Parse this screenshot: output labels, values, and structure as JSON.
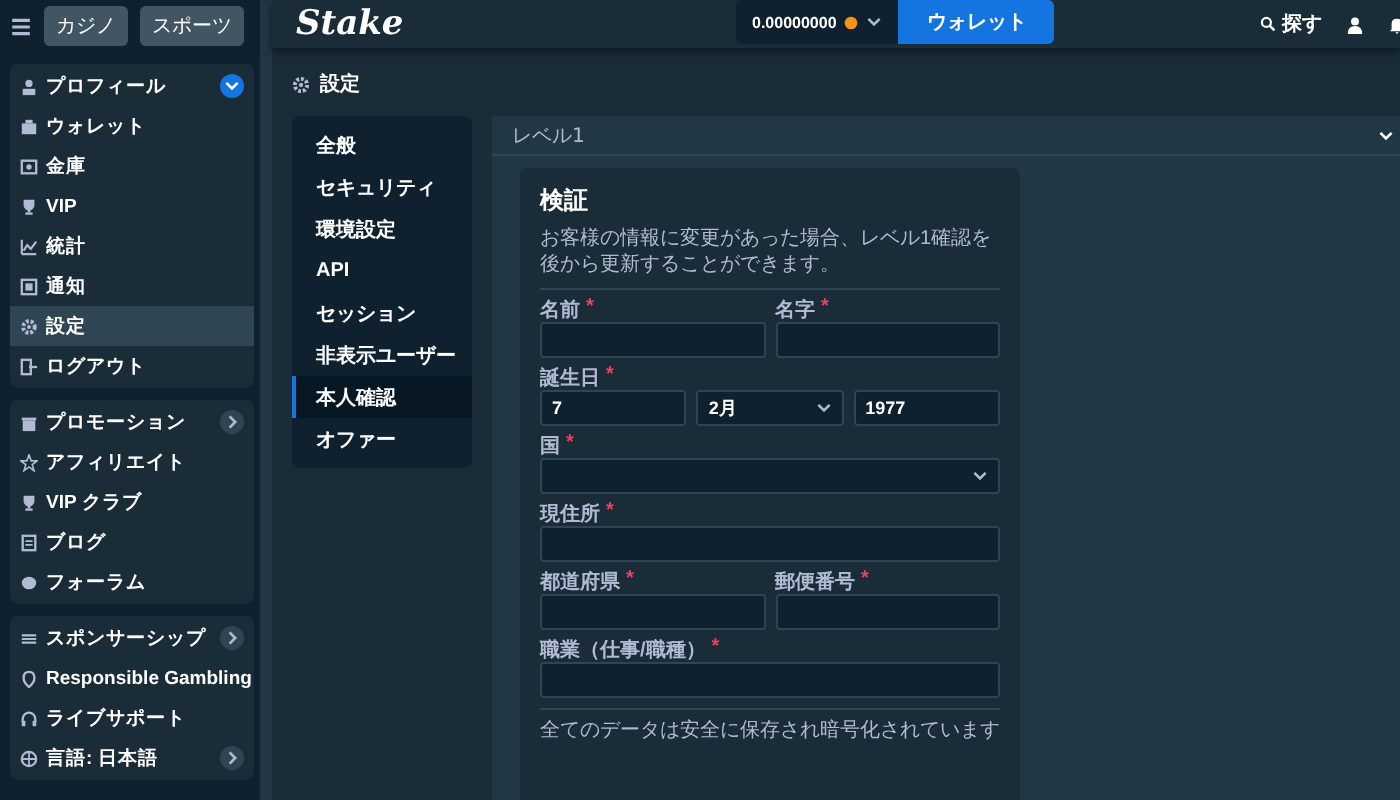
{
  "header": {
    "tabs": [
      {
        "label": "カジノ",
        "selected": false
      },
      {
        "label": "スポーツ",
        "selected": false
      }
    ],
    "logo": "Stake",
    "balance": "0.00000000",
    "wallet_button": "ウォレット",
    "search_label": "探す"
  },
  "sidebar": {
    "groups": [
      {
        "items": [
          {
            "label": "プロフィール",
            "kind": "expandable",
            "expanded": true,
            "selected": false
          },
          {
            "label": "ウォレット",
            "kind": "link",
            "selected": false
          },
          {
            "label": "金庫",
            "kind": "link",
            "selected": false
          },
          {
            "label": "VIP",
            "kind": "link",
            "selected": false
          },
          {
            "label": "統計",
            "kind": "link",
            "selected": false
          },
          {
            "label": "通知",
            "kind": "link",
            "selected": false
          },
          {
            "label": "設定",
            "kind": "link",
            "selected": true
          },
          {
            "label": "ログアウト",
            "kind": "link",
            "selected": false
          }
        ]
      },
      {
        "items": [
          {
            "label": "プロモーション",
            "kind": "expandable",
            "expanded": false,
            "selected": false
          },
          {
            "label": "アフィリエイト",
            "kind": "link",
            "selected": false
          },
          {
            "label": "VIP クラブ",
            "kind": "link",
            "selected": false
          },
          {
            "label": "ブログ",
            "kind": "link",
            "selected": false
          },
          {
            "label": "フォーラム",
            "kind": "link",
            "selected": false
          }
        ]
      },
      {
        "items": [
          {
            "label": "スポンサーシップ",
            "kind": "expandable",
            "expanded": false,
            "selected": false
          },
          {
            "label": "Responsible Gambling",
            "kind": "link",
            "selected": false
          },
          {
            "label": "ライブサポート",
            "kind": "link",
            "selected": false
          },
          {
            "label": "言語: 日本語",
            "kind": "expandable",
            "expanded": false,
            "selected": false
          }
        ]
      }
    ]
  },
  "settings": {
    "title": "設定",
    "menu": [
      {
        "label": "全般",
        "selected": false
      },
      {
        "label": "セキュリティ",
        "selected": false
      },
      {
        "label": "環境設定",
        "selected": false
      },
      {
        "label": "API",
        "selected": false
      },
      {
        "label": "セッション",
        "selected": false
      },
      {
        "label": "非表示ユーザー",
        "selected": false
      },
      {
        "label": "本人確認",
        "selected": true
      },
      {
        "label": "オファー",
        "selected": false
      }
    ],
    "section": {
      "title": "レベル1",
      "expanded": true
    },
    "card": {
      "title": "検証",
      "description": "お客様の情報に変更があった場合、レベル1確認を後から更新することができます。",
      "rows": [
        {
          "fields": [
            {
              "label": "名前",
              "mark": "*",
              "inputs": [
                {
                  "kind": "text"
                }
              ]
            },
            {
              "label": "名字",
              "mark": "*",
              "inputs": [
                {
                  "kind": "text"
                }
              ]
            }
          ]
        },
        {
          "fields": [
            {
              "label": "誕生日",
              "mark": "*",
              "inputs": [
                {
                  "kind": "text",
                  "value": "7"
                },
                {
                  "kind": "select",
                  "value": "2月"
                },
                {
                  "kind": "text",
                  "value": "1977"
                }
              ]
            }
          ]
        },
        {
          "fields": [
            {
              "label": "国",
              "mark": "*",
              "inputs": [
                {
                  "kind": "select"
                }
              ]
            }
          ]
        },
        {
          "fields": [
            {
              "label": "現住所",
              "mark": "*",
              "inputs": [
                {
                  "kind": "text"
                }
              ]
            }
          ]
        },
        {
          "fields": [
            {
              "label": "都道府県",
              "mark": "*",
              "inputs": [
                {
                  "kind": "text"
                }
              ]
            },
            {
              "label": "郵便番号",
              "mark": "*",
              "inputs": [
                {
                  "kind": "text"
                }
              ]
            }
          ]
        },
        {
          "fields": [
            {
              "label": "職業（仕事/職種）",
              "mark": "*",
              "inputs": [
                {
                  "kind": "text"
                }
              ]
            }
          ]
        }
      ],
      "note": "全てのデータは安全に保存され暗号化されています"
    }
  }
}
